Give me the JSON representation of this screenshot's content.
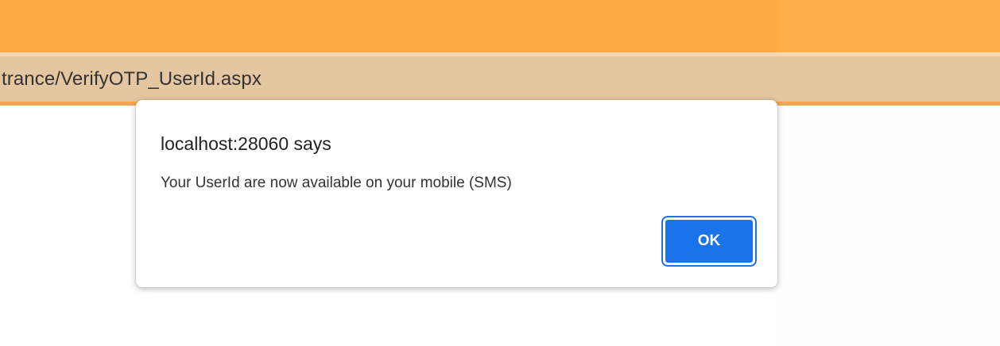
{
  "browser": {
    "address_text": "trance/VerifyOTP_UserId.aspx"
  },
  "dialog": {
    "title": "localhost:28060 says",
    "message": "Your UserId are now available on your mobile (SMS)",
    "ok_label": "OK"
  },
  "colors": {
    "header": "#ffaa44",
    "address_bar": "#e4c6a0",
    "accent": "#1a73e8"
  }
}
